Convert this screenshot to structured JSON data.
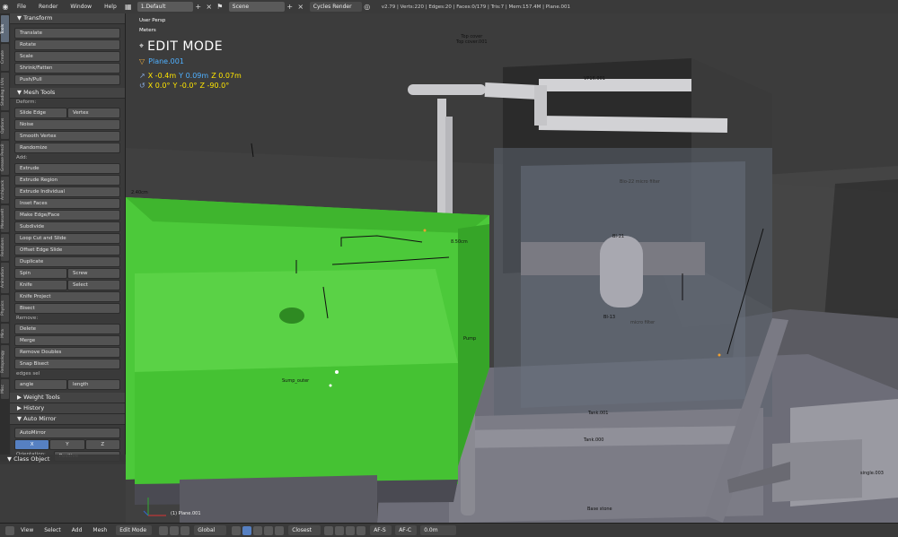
{
  "topbar": {
    "menus": [
      "File",
      "Render",
      "Window",
      "Help"
    ],
    "screen_layout": "1.Default",
    "scene": "Scene",
    "engine": "Cycles Render",
    "stats": "v2.79 | Verts:220 | Edges:20 | Faces:0/179 | Tris:7 | Mem:157.4M | Plane.001"
  },
  "tabs": [
    "Tools",
    "Create",
    "Shading / UVs",
    "Options",
    "Grease Pencil",
    "Archipack",
    "MeasureIt",
    "Relations",
    "Animation",
    "Physics",
    "Mira",
    "Retopology",
    "Misc"
  ],
  "toolshelf": {
    "transform_title": "Transform",
    "transform_buttons": [
      "Translate",
      "Rotate",
      "Scale",
      "Shrink/Fatten",
      "Push/Pull"
    ],
    "meshtools_title": "Mesh Tools",
    "deform_label": "Deform:",
    "slide_edge": "Slide Edge",
    "vertex": "Vertex",
    "noise": "Noise",
    "smooth_vertex": "Smooth Vertex",
    "randomize": "Randomize",
    "add_label": "Add:",
    "extrude": "Extrude",
    "add_buttons": [
      "Extrude Region",
      "Extrude Individual",
      "Inset Faces",
      "Make Edge/Face",
      "Subdivide",
      "Loop Cut and Slide",
      "Offset Edge Slide",
      "Duplicate"
    ],
    "spin": "Spin",
    "screw": "Screw",
    "knife": "Knife",
    "select": "Select",
    "knife_project": "Knife Project",
    "bisect": "Bisect",
    "remove_label": "Remove:",
    "delete": "Delete",
    "merge": "Merge",
    "remove_doubles": "Remove Doubles",
    "snap_bisect": "Snap Bisect",
    "edges_sel": "edges sel",
    "angle": "angle",
    "length": "length",
    "weight_tools": "Weight Tools",
    "history": "History",
    "auto_mirror_title": "Auto Mirror",
    "auto_mirror_btn": "AutoMirror",
    "axes": [
      "X",
      "Y",
      "Z"
    ],
    "orientation_label": "Orientation:",
    "orientation_value": "Positive",
    "class_object": "Class Object"
  },
  "viewport": {
    "view_name": "User Persp",
    "units": "Meters",
    "mode": "EDIT MODE",
    "object_name": "Plane.001",
    "loc_x": "X -0.4m",
    "loc_y": "Y 0.09m",
    "loc_z": "Z 0.07m",
    "rot_x": "X 0.0°",
    "rot_y": "Y -0.0°",
    "rot_z": "Z -90.0°",
    "bottom_object": "(1) Plane.001",
    "labels": {
      "top_cover": "Top cover\nTop cover.001",
      "vp": "VP16.001",
      "filter": "Bio-22 micro filter",
      "bi21": "BI-21",
      "bi13": "BI-13",
      "micro": "micro filter",
      "pump": "Pump",
      "sump": "Sump_outer",
      "tank1": "Tank.001",
      "tank2": "Tank.000",
      "base": "Base stone",
      "single": "single.003",
      "r40": "2.40cm",
      "r50": "8.50cm"
    }
  },
  "bottombar": {
    "menus": [
      "View",
      "Select",
      "Add",
      "Mesh"
    ],
    "mode": "Edit Mode",
    "pivot": "Global",
    "proportional": "Closest",
    "snap_a": "AF-S",
    "snap_b": "AF-C",
    "offset": "0.0m"
  }
}
